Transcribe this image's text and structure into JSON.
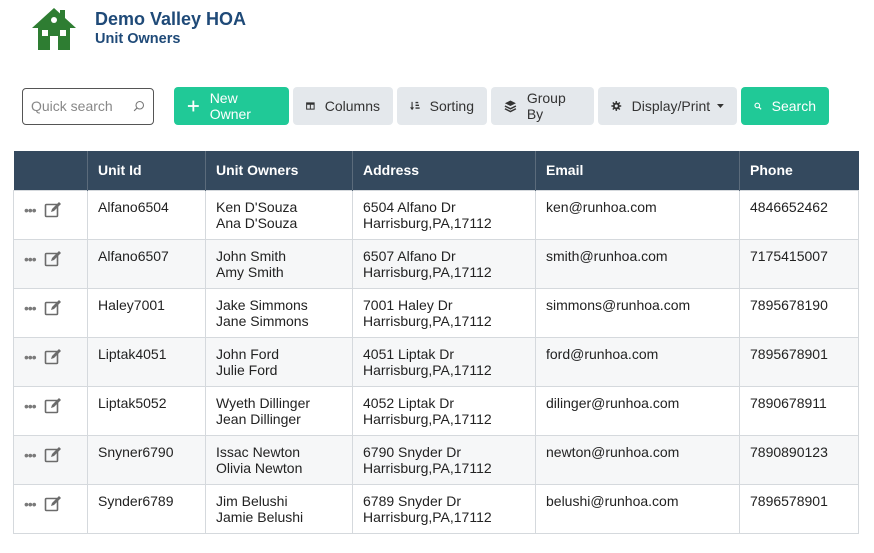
{
  "header": {
    "title": "Demo Valley HOA",
    "subtitle": "Unit Owners",
    "logo_icon": "house-icon",
    "brand_color": "#2e7d32"
  },
  "toolbar": {
    "search_placeholder": "Quick search",
    "new_owner_label": "New Owner",
    "columns_label": "Columns",
    "sorting_label": "Sorting",
    "group_by_label": "Group By",
    "display_print_label": "Display/Print",
    "search_label": "Search"
  },
  "colors": {
    "accent": "#20c997",
    "header_bg": "#34495e",
    "title": "#1f4a78"
  },
  "table": {
    "columns": [
      "",
      "Unit Id",
      "Unit Owners",
      "Address",
      "Email",
      "Phone"
    ],
    "rows": [
      {
        "unit_id": "Alfano6504",
        "owner1": "Ken D'Souza",
        "owner2": "Ana D'Souza",
        "addr1": "6504 Alfano Dr",
        "addr2": "Harrisburg,PA,17112",
        "email": "ken@runhoa.com",
        "phone": "4846652462"
      },
      {
        "unit_id": "Alfano6507",
        "owner1": "John Smith",
        "owner2": "Amy Smith",
        "addr1": "6507 Alfano Dr",
        "addr2": "Harrisburg,PA,17112",
        "email": "smith@runhoa.com",
        "phone": "7175415007"
      },
      {
        "unit_id": "Haley7001",
        "owner1": "Jake Simmons",
        "owner2": "Jane Simmons",
        "addr1": "7001 Haley Dr",
        "addr2": "Harrisburg,PA,17112",
        "email": "simmons@runhoa.com",
        "phone": "7895678190"
      },
      {
        "unit_id": "Liptak4051",
        "owner1": "John Ford",
        "owner2": "Julie Ford",
        "addr1": "4051 Liptak Dr",
        "addr2": "Harrisburg,PA,17112",
        "email": "ford@runhoa.com",
        "phone": "7895678901"
      },
      {
        "unit_id": "Liptak5052",
        "owner1": "Wyeth Dillinger",
        "owner2": "Jean Dillinger",
        "addr1": "4052 Liptak Dr",
        "addr2": "Harrisburg,PA,17112",
        "email": "dilinger@runhoa.com",
        "phone": "7890678911"
      },
      {
        "unit_id": "Snyner6790",
        "owner1": "Issac Newton",
        "owner2": "Olivia Newton",
        "addr1": "6790 Snyder Dr",
        "addr2": "Harrisburg,PA,17112",
        "email": "newton@runhoa.com",
        "phone": "7890890123"
      },
      {
        "unit_id": "Synder6789",
        "owner1": "Jim Belushi",
        "owner2": "Jamie Belushi",
        "addr1": "6789 Snyder Dr",
        "addr2": "Harrisburg,PA,17112",
        "email": "belushi@runhoa.com",
        "phone": "7896578901"
      }
    ]
  }
}
